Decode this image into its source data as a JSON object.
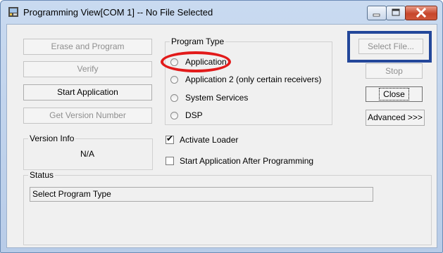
{
  "window": {
    "title": "Programming View[COM 1] -- No File Selected"
  },
  "left_buttons": [
    {
      "label": "Erase and Program",
      "enabled": false
    },
    {
      "label": "Verify",
      "enabled": false
    },
    {
      "label": "Start Application",
      "enabled": true
    },
    {
      "label": "Get Version Number",
      "enabled": false
    }
  ],
  "version_info": {
    "label": "Version Info",
    "value": "N/A"
  },
  "program_type": {
    "label": "Program Type",
    "options": [
      {
        "label": "Application",
        "selected": false
      },
      {
        "label": "Application 2 (only certain receivers)",
        "selected": false
      },
      {
        "label": "System Services",
        "selected": false
      },
      {
        "label": "DSP",
        "selected": false
      }
    ]
  },
  "checkboxes": [
    {
      "label": "Activate Loader",
      "checked": true
    },
    {
      "label": "Start Application After Programming",
      "checked": false
    }
  ],
  "right_buttons": {
    "select_file": "Select File...",
    "stop": "Stop",
    "close": "Close",
    "advanced": "Advanced >>>"
  },
  "status": {
    "label": "Status",
    "text": "Select Program Type"
  },
  "annotation_colors": {
    "ellipse": "#e21a1a",
    "rectangle": "#23479a"
  }
}
